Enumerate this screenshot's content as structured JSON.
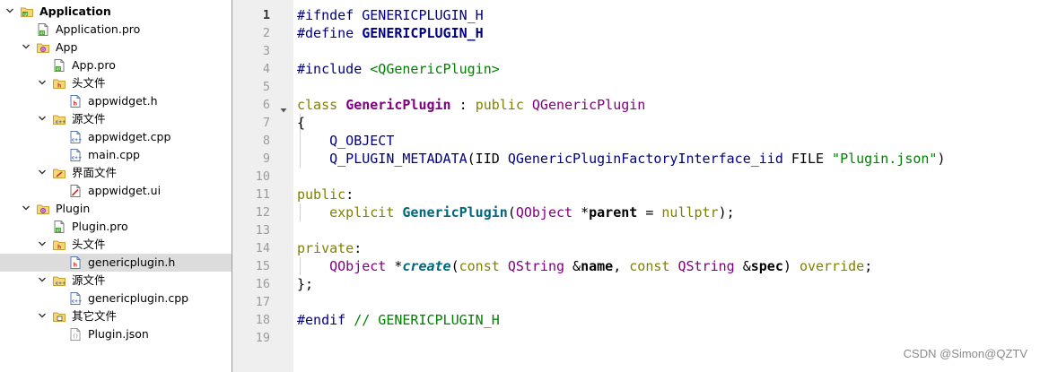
{
  "tree": {
    "items": [
      {
        "label": "Application",
        "icon": "qt-project-icon",
        "expanded": true,
        "bold": true
      },
      {
        "label": "Application.pro",
        "icon": "pro-file-icon"
      },
      {
        "label": "App",
        "icon": "subproject-icon",
        "expanded": true
      },
      {
        "label": "App.pro",
        "icon": "pro-file-icon"
      },
      {
        "label": "头文件",
        "icon": "header-folder-icon",
        "expanded": true
      },
      {
        "label": "appwidget.h",
        "icon": "header-file-icon"
      },
      {
        "label": "源文件",
        "icon": "source-folder-icon",
        "expanded": true
      },
      {
        "label": "appwidget.cpp",
        "icon": "cpp-file-icon"
      },
      {
        "label": "main.cpp",
        "icon": "cpp-file-icon"
      },
      {
        "label": "界面文件",
        "icon": "forms-folder-icon",
        "expanded": true
      },
      {
        "label": "appwidget.ui",
        "icon": "ui-file-icon"
      },
      {
        "label": "Plugin",
        "icon": "subproject-icon",
        "expanded": true
      },
      {
        "label": "Plugin.pro",
        "icon": "pro-file-icon"
      },
      {
        "label": "头文件",
        "icon": "header-folder-icon",
        "expanded": true
      },
      {
        "label": "genericplugin.h",
        "icon": "header-file-icon",
        "selected": true
      },
      {
        "label": "源文件",
        "icon": "source-folder-icon",
        "expanded": true
      },
      {
        "label": "genericplugin.cpp",
        "icon": "cpp-file-icon"
      },
      {
        "label": "其它文件",
        "icon": "other-folder-icon",
        "expanded": true
      },
      {
        "label": "Plugin.json",
        "icon": "json-file-icon"
      }
    ]
  },
  "editor": {
    "current_line": 1,
    "line_numbers": [
      "1",
      "2",
      "3",
      "4",
      "5",
      "6",
      "7",
      "8",
      "9",
      "10",
      "11",
      "12",
      "13",
      "14",
      "15",
      "16",
      "17",
      "18",
      "19"
    ],
    "lines": [
      [
        [
          "pp",
          "#ifndef "
        ],
        [
          "pp",
          "GENERICPLUGIN_H"
        ]
      ],
      [
        [
          "pp",
          "#define "
        ],
        [
          "ppb",
          "GENERICPLUGIN_H"
        ]
      ],
      [],
      [
        [
          "pp",
          "#include "
        ],
        [
          "str",
          "<QGenericPlugin>"
        ]
      ],
      [],
      [
        [
          "kw",
          "class "
        ],
        [
          "typeb",
          "GenericPlugin"
        ],
        [
          "p",
          " : "
        ],
        [
          "kw",
          "public "
        ],
        [
          "type",
          "QGenericPlugin"
        ]
      ],
      [
        [
          "p",
          "{"
        ]
      ],
      [
        [
          "p",
          "    "
        ],
        [
          "mac",
          "Q_OBJECT"
        ]
      ],
      [
        [
          "p",
          "    "
        ],
        [
          "mac",
          "Q_PLUGIN_METADATA"
        ],
        [
          "p",
          "(IID "
        ],
        [
          "mac",
          "QGenericPluginFactoryInterface_iid"
        ],
        [
          "p",
          " FILE "
        ],
        [
          "str",
          "\"Plugin.json\""
        ],
        [
          "p",
          ")"
        ]
      ],
      [],
      [
        [
          "kw",
          "public"
        ],
        [
          "p",
          ":"
        ]
      ],
      [
        [
          "p",
          "    "
        ],
        [
          "kw",
          "explicit "
        ],
        [
          "fn",
          "GenericPlugin"
        ],
        [
          "p",
          "("
        ],
        [
          "type",
          "QObject"
        ],
        [
          "p",
          " *"
        ],
        [
          "par",
          "parent"
        ],
        [
          "p",
          " = "
        ],
        [
          "kw",
          "nullptr"
        ],
        [
          "p",
          ");"
        ]
      ],
      [],
      [
        [
          "kw",
          "private"
        ],
        [
          "p",
          ":"
        ]
      ],
      [
        [
          "p",
          "    "
        ],
        [
          "type",
          "QObject"
        ],
        [
          "p",
          " *"
        ],
        [
          "fni",
          "create"
        ],
        [
          "p",
          "("
        ],
        [
          "kw",
          "const "
        ],
        [
          "type",
          "QString"
        ],
        [
          "p",
          " &"
        ],
        [
          "par",
          "name"
        ],
        [
          "p",
          ", "
        ],
        [
          "kw",
          "const "
        ],
        [
          "type",
          "QString"
        ],
        [
          "p",
          " &"
        ],
        [
          "par",
          "spec"
        ],
        [
          "p",
          ") "
        ],
        [
          "kw",
          "override"
        ],
        [
          "p",
          ";"
        ]
      ],
      [
        [
          "p",
          "};"
        ]
      ],
      [],
      [
        [
          "pp",
          "#endif "
        ],
        [
          "cm",
          "// GENERICPLUGIN_H"
        ]
      ],
      []
    ]
  },
  "watermark": "CSDN @Simon@QZTV",
  "colors": {
    "selection": "#dcdcdc",
    "gutter": "#efefef",
    "keyword": "#808000",
    "preprocessor": "#000080",
    "string": "#008000",
    "type": "#800080",
    "function": "#00677c"
  }
}
